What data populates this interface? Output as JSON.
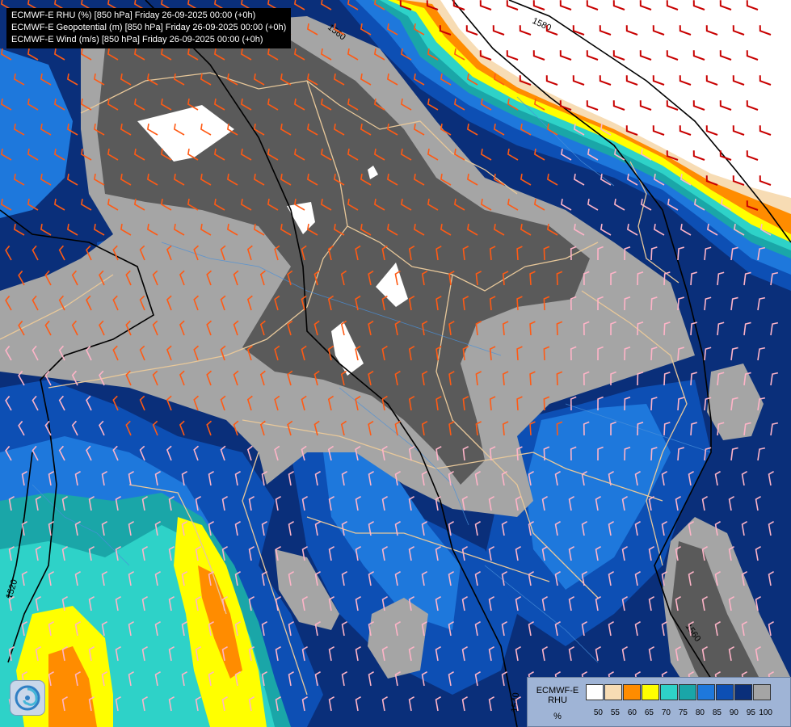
{
  "header": {
    "lines": [
      "ECMWF-E RHU (%) [850 hPa] Friday 26-09-2025 00:00 (+0h)",
      "ECMWF-E Geopotential (m) [850 hPa] Friday 26-09-2025 00:00 (+0h)",
      "ECMWF-E Wind (m/s) [850 hPa] Friday 26-09-2025 00:00 (+0h)"
    ]
  },
  "legend": {
    "model": "ECMWF-E",
    "variable": "RHU",
    "unit": "%",
    "ticks": [
      "50",
      "55",
      "60",
      "65",
      "70",
      "75",
      "80",
      "85",
      "90",
      "95",
      "100"
    ],
    "colors": [
      "#ffffff",
      "#f7dcb4",
      "#ff8c00",
      "#ffff00",
      "#2ed2c8",
      "#1aa6a8",
      "#1e78dc",
      "#0d4fb4",
      "#0a2f7a",
      "#a5a5a5",
      "#5a5a5a"
    ]
  },
  "contours": {
    "labels": [
      "1580",
      "1560",
      "1520",
      "1540",
      "1560"
    ]
  },
  "palette": {
    "dark_blue": "#0a2f7a",
    "mid_blue": "#0d4fb4",
    "light_blue": "#1e78dc",
    "teal": "#1aa6a8",
    "cyan": "#2ed2c8",
    "yellow": "#ffff00",
    "orange": "#ff8c00",
    "cream": "#f7dcb4",
    "light_gray": "#a5a5a5",
    "dark_gray": "#5a5a5a",
    "white": "#ffffff",
    "border_line": "#e8c89a",
    "river": "#4a90d9",
    "barb_orange": "#ff5a14",
    "barb_pink": "#ffb4c8",
    "barb_red": "#c80000"
  }
}
